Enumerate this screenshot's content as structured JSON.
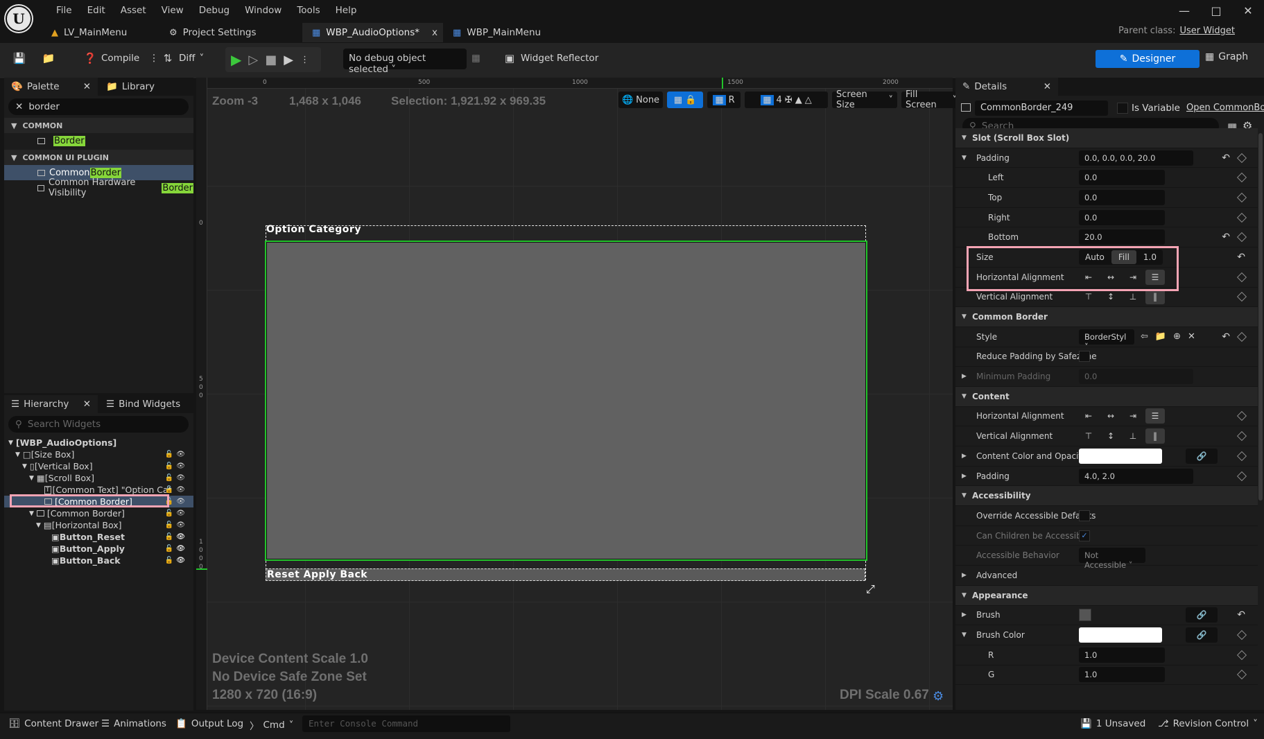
{
  "menu": [
    "File",
    "Edit",
    "Asset",
    "View",
    "Debug",
    "Window",
    "Tools",
    "Help"
  ],
  "tabs": [
    {
      "label": "LV_MainMenu"
    },
    {
      "label": "Project Settings"
    },
    {
      "label": "WBP_AudioOptions*",
      "close": "x"
    },
    {
      "label": "WBP_MainMenu"
    }
  ],
  "parent_class": {
    "label": "Parent class:",
    "value": "User Widget"
  },
  "toolbar": {
    "compile": "Compile",
    "diff": "Diff",
    "debug_object": "No debug object selected",
    "widget_reflector": "Widget Reflector",
    "designer": "Designer",
    "graph": "Graph"
  },
  "palette": {
    "tab": "Palette",
    "library": "Library",
    "search": "border",
    "categories": [
      {
        "name": "COMMON",
        "items": [
          {
            "prefix": "",
            "match": "Border"
          }
        ]
      },
      {
        "name": "COMMON UI PLUGIN",
        "items": [
          {
            "prefix": "Common ",
            "match": "Border"
          },
          {
            "prefix": "Common Hardware Visibility ",
            "match": "Border"
          }
        ]
      }
    ]
  },
  "hierarchy": {
    "tab": "Hierarchy",
    "bind": "Bind Widgets",
    "search_placeholder": "Search Widgets",
    "rows": [
      "[WBP_AudioOptions]",
      "[Size Box]",
      "[Vertical Box]",
      "[Scroll Box]",
      "[Common Text] \"Option Cat",
      "[Common Border]",
      "[Common Border]",
      "[Horizontal Box]",
      "Button_Reset",
      "Button_Apply",
      "Button_Back"
    ]
  },
  "canvas": {
    "zoom": "Zoom -3",
    "size": "1,468 x 1,046",
    "selection": "Selection: 1,921.92 x 969.35",
    "none": "None",
    "r": "R",
    "grid_num": "4",
    "screen_size": "Screen Size",
    "fill_screen": "Fill Screen",
    "ruler_h": [
      "0",
      "500",
      "1000",
      "1500",
      "2000"
    ],
    "ruler_v": [
      "0",
      "5",
      "0",
      "0",
      "1",
      "0",
      "0",
      "0"
    ],
    "option_category": "Option Category",
    "buttons_text": "Reset Apply Back",
    "device_scale": "Device Content Scale 1.0",
    "safe_zone": "No Device Safe Zone Set",
    "resolution": "1280 x 720 (16:9)",
    "dpi": "DPI Scale 0.67"
  },
  "details": {
    "tab": "Details",
    "name": "CommonBorder_249",
    "is_variable": "Is Variable",
    "open": "Open CommonBord",
    "search": "Search",
    "slot": "Slot (Scroll Box Slot)",
    "padding": "Padding",
    "padding_val": "0.0, 0.0, 0.0, 20.0",
    "left": "Left",
    "left_val": "0.0",
    "top": "Top",
    "top_val": "0.0",
    "right": "Right",
    "right_val": "0.0",
    "bottom": "Bottom",
    "bottom_val": "20.0",
    "size": "Size",
    "auto": "Auto",
    "fill": "Fill",
    "fill_val": "1.0",
    "halign": "Horizontal Alignment",
    "valign": "Vertical Alignment",
    "common_border": "Common Border",
    "style": "Style",
    "style_val": "BorderStyl",
    "reduce": "Reduce Padding by Safezone",
    "min_padding": "Minimum Padding",
    "min_padding_val": "0.0",
    "content": "Content",
    "c_halign": "Horizontal Alignment",
    "c_valign": "Vertical Alignment",
    "color_opacity": "Content Color and Opacity",
    "c_padding": "Padding",
    "c_padding_val": "4.0, 2.0",
    "accessibility": "Accessibility",
    "override": "Override Accessible Defaults",
    "children": "Can Children be Accessible",
    "behavior": "Accessible Behavior",
    "behavior_val": "Not Accessible",
    "advanced": "Advanced",
    "appearance": "Appearance",
    "brush": "Brush",
    "brush_color": "Brush Color",
    "r": "R",
    "r_val": "1.0",
    "g": "G",
    "g_val": "1.0"
  },
  "status": {
    "content_drawer": "Content Drawer",
    "animations": "Animations",
    "output_log": "Output Log",
    "cmd": "Cmd",
    "console_placeholder": "Enter Console Command",
    "unsaved": "1 Unsaved",
    "revision": "Revision Control"
  },
  "colors": {
    "accent": "#0e70d8",
    "highlight": "#86d63a",
    "selection": "#f4a4b4",
    "green": "#22c42a"
  }
}
